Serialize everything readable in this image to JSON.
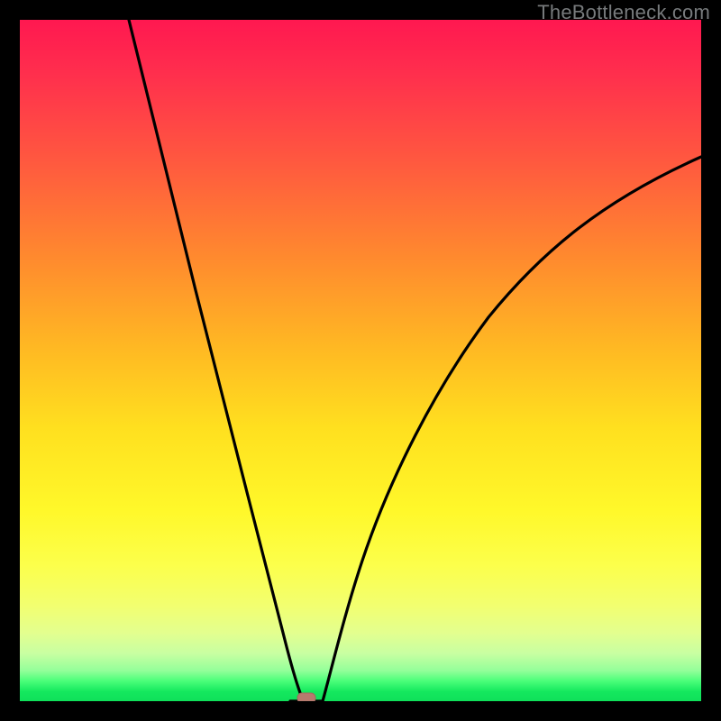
{
  "watermark": "TheBottleneck.com",
  "colors": {
    "frame": "#000000",
    "curve": "#000000",
    "marker_fill": "#b67a6e",
    "marker_stroke": "#a2695e",
    "gradient_top": "#ff1850",
    "gradient_bottom": "#0fe05a"
  },
  "chart_data": {
    "type": "line",
    "title": "",
    "xlabel": "",
    "ylabel": "",
    "xlim": [
      0,
      100
    ],
    "ylim": [
      0,
      100
    ],
    "grid": false,
    "notes": "V-shaped bottleneck curve; no axis tick labels visible.",
    "reference_marker": {
      "x": 42,
      "y": 0
    },
    "series": [
      {
        "name": "bottleneck-curve",
        "x": [
          16,
          20,
          24,
          28,
          32,
          36,
          39,
          41,
          42,
          44,
          46,
          50,
          55,
          60,
          66,
          72,
          78,
          85,
          92,
          100
        ],
        "values": [
          100,
          86,
          72,
          59,
          45,
          30,
          15,
          3,
          0,
          4,
          13,
          27,
          40,
          50,
          58,
          65,
          70,
          74,
          77,
          80
        ]
      }
    ]
  }
}
